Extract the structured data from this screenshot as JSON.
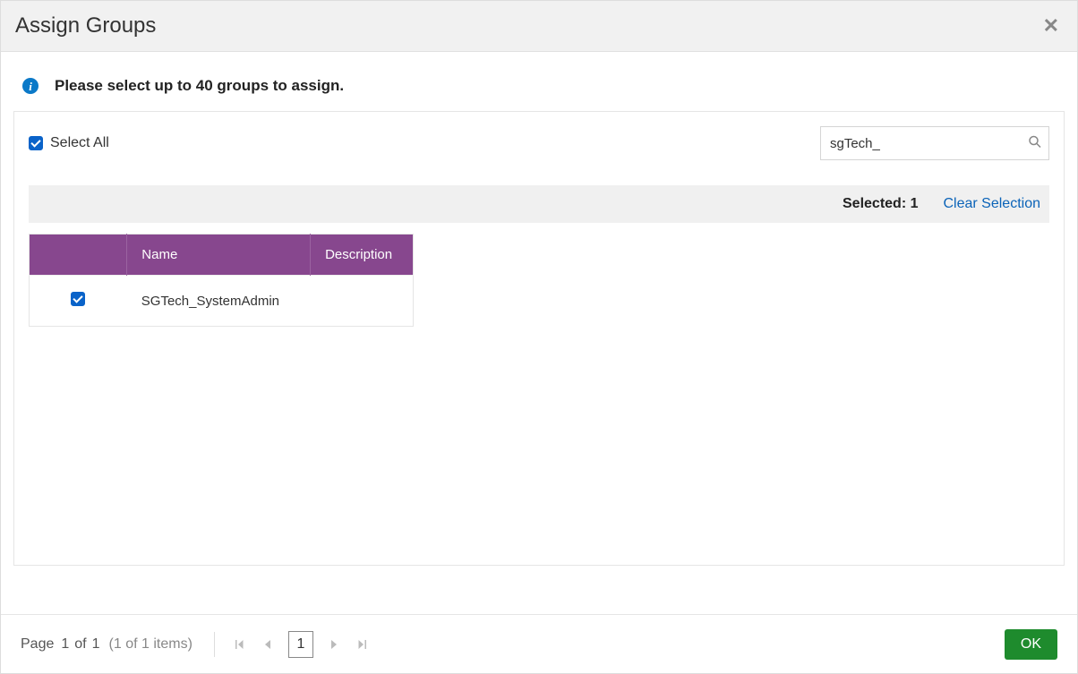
{
  "dialog": {
    "title": "Assign Groups",
    "info_message": "Please select up to 40 groups to assign.",
    "select_all_label": "Select All",
    "search": {
      "value": "sgTech_"
    },
    "status": {
      "selected_label": "Selected:",
      "selected_count": "1",
      "clear_label": "Clear Selection"
    },
    "table": {
      "headers": {
        "name": "Name",
        "description": "Description"
      },
      "rows": [
        {
          "checked": true,
          "name": "SGTech_SystemAdmin",
          "description": ""
        }
      ]
    },
    "pager": {
      "page_word": "Page",
      "current": "1",
      "of_word": "of",
      "total": "1",
      "items_text": "(1 of 1 items)",
      "page_number_box": "1"
    },
    "ok_label": "OK"
  }
}
